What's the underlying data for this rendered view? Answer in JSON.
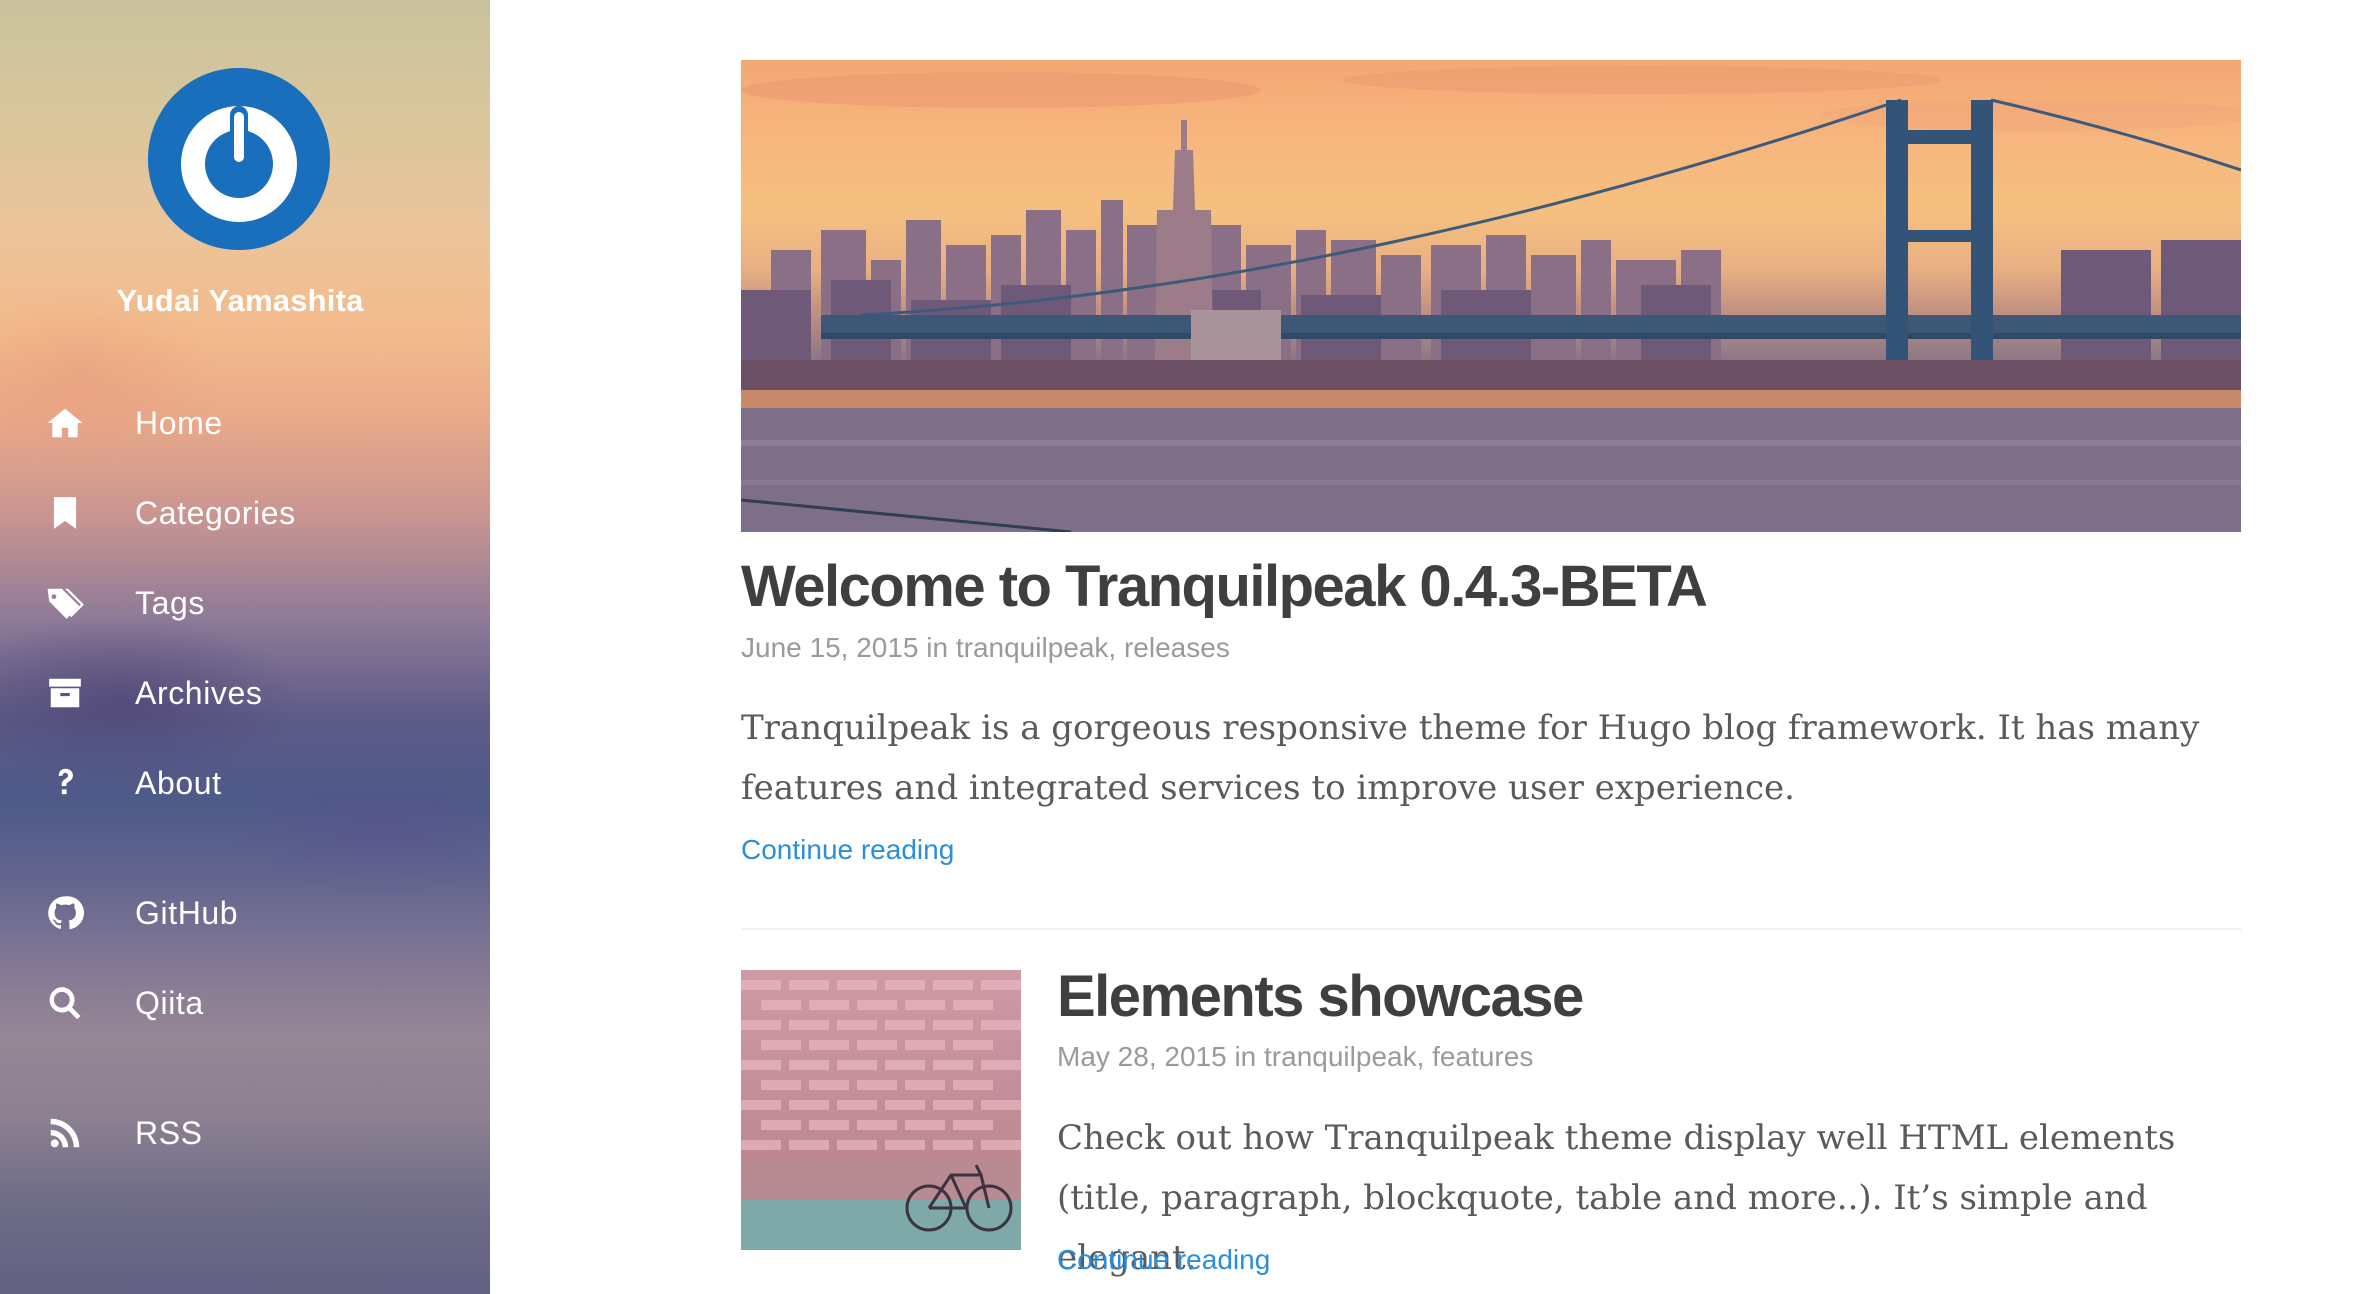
{
  "sidebar": {
    "author_name": "Yudai Yamashita",
    "menu": [
      {
        "label": "Home",
        "icon": "home-icon"
      },
      {
        "label": "Categories",
        "icon": "bookmark-icon"
      },
      {
        "label": "Tags",
        "icon": "tags-icon"
      },
      {
        "label": "Archives",
        "icon": "archive-icon"
      },
      {
        "label": "About",
        "icon": "question-icon"
      }
    ],
    "links": [
      {
        "label": "GitHub",
        "icon": "github-icon"
      },
      {
        "label": "Qiita",
        "icon": "search-icon"
      }
    ],
    "feeds": [
      {
        "label": "RSS",
        "icon": "rss-icon"
      }
    ]
  },
  "posts": [
    {
      "title": "Welcome to Tranquilpeak 0.4.3-BETA",
      "date": "June 15, 2015",
      "in_word": "in",
      "categories": [
        "tranquilpeak",
        "releases"
      ],
      "excerpt": "Tranquilpeak is a gorgeous responsive theme for Hugo blog framework. It has many features and integrated services to improve user experience.",
      "continue": "Continue reading"
    },
    {
      "title": "Elements showcase",
      "date": "May 28, 2015",
      "in_word": "in",
      "categories": [
        "tranquilpeak",
        "features"
      ],
      "excerpt": "Check out how Tranquilpeak theme display well HTML elements (title, paragraph, blockquote, table and more..). It’s simple and elegant.",
      "continue": "Continue reading"
    }
  ],
  "colors": {
    "link": "#2a8ede",
    "title": "#3f3f3f",
    "meta": "#9a9a9a",
    "avatar": "#1a6fbc"
  }
}
